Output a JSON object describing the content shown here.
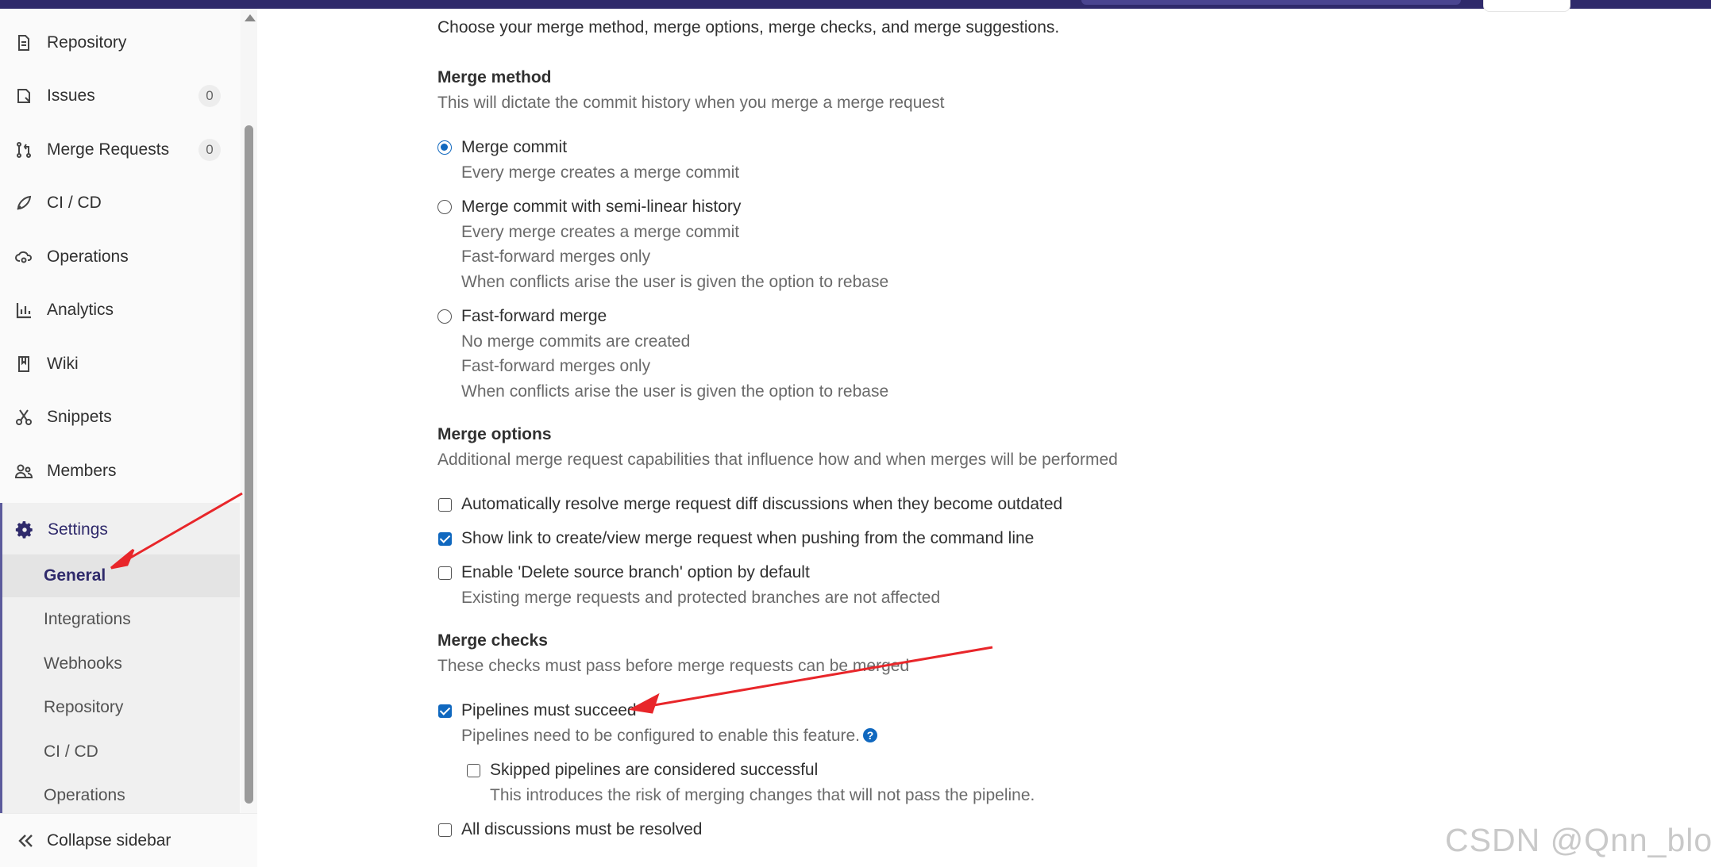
{
  "sidebar": {
    "items": [
      {
        "label": "Repository",
        "icon": "document-icon"
      },
      {
        "label": "Issues",
        "icon": "issues-icon",
        "count": "0"
      },
      {
        "label": "Merge Requests",
        "icon": "merge-request-icon",
        "count": "0"
      },
      {
        "label": "CI / CD",
        "icon": "rocket-icon"
      },
      {
        "label": "Operations",
        "icon": "cloud-gear-icon"
      },
      {
        "label": "Analytics",
        "icon": "chart-icon"
      },
      {
        "label": "Wiki",
        "icon": "book-icon"
      },
      {
        "label": "Snippets",
        "icon": "scissors-icon"
      },
      {
        "label": "Members",
        "icon": "users-icon"
      }
    ],
    "settings": {
      "label": "Settings",
      "icon": "gear-icon",
      "sub_items": [
        "General",
        "Integrations",
        "Webhooks",
        "Repository",
        "CI / CD",
        "Operations"
      ],
      "active": "General"
    },
    "collapse_label": "Collapse sidebar"
  },
  "main": {
    "intro": "Choose your merge method, merge options, merge checks, and merge suggestions.",
    "merge_method": {
      "title": "Merge method",
      "description": "This will dictate the commit history when you merge a merge request",
      "options": [
        {
          "label": "Merge commit",
          "selected": true,
          "help": [
            "Every merge creates a merge commit"
          ]
        },
        {
          "label": "Merge commit with semi-linear history",
          "selected": false,
          "help": [
            "Every merge creates a merge commit",
            "Fast-forward merges only",
            "When conflicts arise the user is given the option to rebase"
          ]
        },
        {
          "label": "Fast-forward merge",
          "selected": false,
          "help": [
            "No merge commits are created",
            "Fast-forward merges only",
            "When conflicts arise the user is given the option to rebase"
          ]
        }
      ]
    },
    "merge_options": {
      "title": "Merge options",
      "description": "Additional merge request capabilities that influence how and when merges will be performed",
      "options": [
        {
          "label": "Automatically resolve merge request diff discussions when they become outdated",
          "checked": false
        },
        {
          "label": "Show link to create/view merge request when pushing from the command line",
          "checked": true
        },
        {
          "label": "Enable 'Delete source branch' option by default",
          "checked": false,
          "help": "Existing merge requests and protected branches are not affected"
        }
      ]
    },
    "merge_checks": {
      "title": "Merge checks",
      "description": "These checks must pass before merge requests can be merged",
      "pipelines": {
        "label": "Pipelines must succeed",
        "checked": true,
        "help": "Pipelines need to be configured to enable this feature.",
        "help_icon": "?"
      },
      "skipped": {
        "label": "Skipped pipelines are considered successful",
        "checked": false,
        "help": "This introduces the risk of merging changes that will not pass the pipeline."
      },
      "discussions": {
        "label": "All discussions must be resolved",
        "checked": false
      }
    }
  },
  "annotation_color": "#e8262a",
  "watermark": "CSDN @Qnn_blog"
}
